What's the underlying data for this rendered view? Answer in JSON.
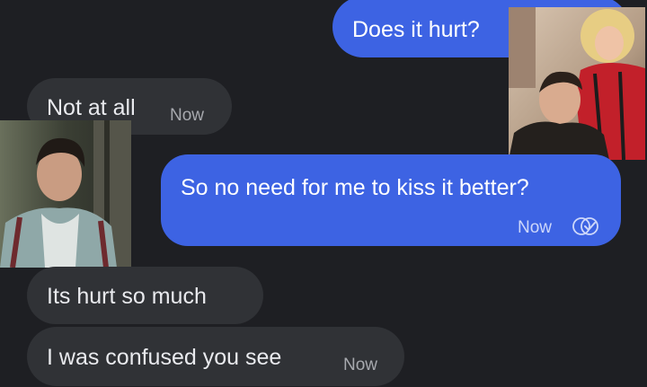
{
  "messages": [
    {
      "id": "m1",
      "direction": "sent",
      "text": "Does it hurt?"
    },
    {
      "id": "m2",
      "direction": "received",
      "text": "Not at all",
      "time": "Now"
    },
    {
      "id": "m3",
      "direction": "sent",
      "text": "So no need for me to kiss it better?",
      "time": "Now",
      "status_icon": "read-receipt-icon"
    },
    {
      "id": "m4",
      "direction": "received",
      "text": "Its hurt so much"
    },
    {
      "id": "m5",
      "direction": "received",
      "text": "I was confused you see",
      "time": "Now"
    }
  ],
  "avatars": [
    {
      "id": "sender-photo",
      "icon": "person-photo"
    },
    {
      "id": "recipient-photo",
      "icon": "person-photo"
    }
  ],
  "colors": {
    "background": "#1e1f23",
    "sent_bubble": "#3d63e3",
    "received_bubble": "#303236"
  }
}
